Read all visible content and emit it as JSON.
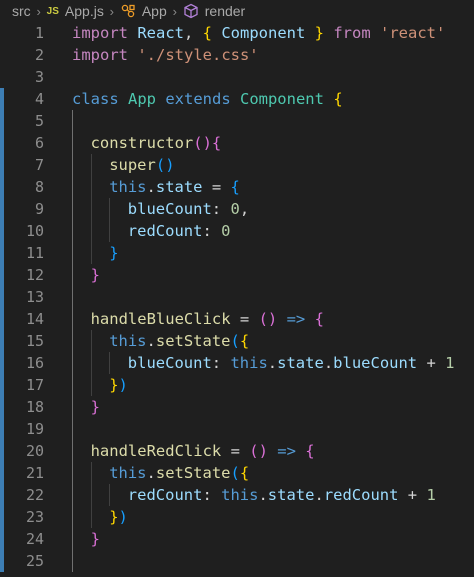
{
  "breadcrumb": {
    "folder": "src",
    "file_badge": "JS",
    "file": "App.js",
    "class_name": "App",
    "method": "render"
  },
  "lines": [
    {
      "n": "1",
      "indent": 0,
      "tokens": [
        [
          "import ",
          "k"
        ],
        [
          "React",
          "v"
        ],
        [
          ", ",
          "p"
        ],
        [
          "{",
          "y"
        ],
        [
          " Component ",
          "v"
        ],
        [
          "}",
          "y"
        ],
        [
          " from ",
          "k"
        ],
        [
          "'react'",
          "s"
        ]
      ]
    },
    {
      "n": "2",
      "indent": 0,
      "tokens": [
        [
          "import ",
          "k"
        ],
        [
          "'./style.css'",
          "s"
        ]
      ]
    },
    {
      "n": "3",
      "indent": 0,
      "tokens": []
    },
    {
      "n": "4",
      "indent": 0,
      "tokens": [
        [
          "class ",
          "b"
        ],
        [
          "App ",
          "t"
        ],
        [
          "extends ",
          "b"
        ],
        [
          "Component ",
          "t"
        ],
        [
          "{",
          "y"
        ]
      ]
    },
    {
      "n": "5",
      "indent": 1,
      "tokens": []
    },
    {
      "n": "6",
      "indent": 1,
      "tokens": [
        [
          "constructor",
          "f"
        ],
        [
          "()",
          "m"
        ],
        [
          "{",
          "m"
        ]
      ]
    },
    {
      "n": "7",
      "indent": 2,
      "tokens": [
        [
          "super",
          "f"
        ],
        [
          "()",
          "c"
        ]
      ]
    },
    {
      "n": "8",
      "indent": 2,
      "tokens": [
        [
          "this",
          "b"
        ],
        [
          ".",
          "p"
        ],
        [
          "state",
          "v"
        ],
        [
          " = ",
          "p"
        ],
        [
          "{",
          "c"
        ]
      ]
    },
    {
      "n": "9",
      "indent": 3,
      "tokens": [
        [
          "blueCount",
          "v"
        ],
        [
          ": ",
          "p"
        ],
        [
          "0",
          "n"
        ],
        [
          ",",
          "p"
        ]
      ]
    },
    {
      "n": "10",
      "indent": 3,
      "tokens": [
        [
          "redCount",
          "v"
        ],
        [
          ": ",
          "p"
        ],
        [
          "0",
          "n"
        ]
      ]
    },
    {
      "n": "11",
      "indent": 2,
      "tokens": [
        [
          "}",
          "c"
        ]
      ]
    },
    {
      "n": "12",
      "indent": 1,
      "tokens": [
        [
          "}",
          "m"
        ]
      ]
    },
    {
      "n": "13",
      "indent": 1,
      "tokens": []
    },
    {
      "n": "14",
      "indent": 1,
      "tokens": [
        [
          "handleBlueClick",
          "f"
        ],
        [
          " = ",
          "p"
        ],
        [
          "()",
          "m"
        ],
        [
          " => ",
          "b"
        ],
        [
          "{",
          "m"
        ]
      ]
    },
    {
      "n": "15",
      "indent": 2,
      "tokens": [
        [
          "this",
          "b"
        ],
        [
          ".",
          "p"
        ],
        [
          "setState",
          "f"
        ],
        [
          "(",
          "c"
        ],
        [
          "{",
          "y"
        ]
      ]
    },
    {
      "n": "16",
      "indent": 3,
      "tokens": [
        [
          "blueCount",
          "v"
        ],
        [
          ": ",
          "p"
        ],
        [
          "this",
          "b"
        ],
        [
          ".",
          "p"
        ],
        [
          "state",
          "v"
        ],
        [
          ".",
          "p"
        ],
        [
          "blueCount",
          "v"
        ],
        [
          " + ",
          "p"
        ],
        [
          "1",
          "n"
        ]
      ]
    },
    {
      "n": "17",
      "indent": 2,
      "tokens": [
        [
          "}",
          "y"
        ],
        [
          ")",
          "c"
        ]
      ]
    },
    {
      "n": "18",
      "indent": 1,
      "tokens": [
        [
          "}",
          "m"
        ]
      ]
    },
    {
      "n": "19",
      "indent": 1,
      "tokens": []
    },
    {
      "n": "20",
      "indent": 1,
      "tokens": [
        [
          "handleRedClick",
          "f"
        ],
        [
          " = ",
          "p"
        ],
        [
          "()",
          "m"
        ],
        [
          " => ",
          "b"
        ],
        [
          "{",
          "m"
        ]
      ]
    },
    {
      "n": "21",
      "indent": 2,
      "tokens": [
        [
          "this",
          "b"
        ],
        [
          ".",
          "p"
        ],
        [
          "setState",
          "f"
        ],
        [
          "(",
          "c"
        ],
        [
          "{",
          "y"
        ]
      ]
    },
    {
      "n": "22",
      "indent": 3,
      "tokens": [
        [
          "redCount",
          "v"
        ],
        [
          ": ",
          "p"
        ],
        [
          "this",
          "b"
        ],
        [
          ".",
          "p"
        ],
        [
          "state",
          "v"
        ],
        [
          ".",
          "p"
        ],
        [
          "redCount",
          "v"
        ],
        [
          " + ",
          "p"
        ],
        [
          "1",
          "n"
        ]
      ]
    },
    {
      "n": "23",
      "indent": 2,
      "tokens": [
        [
          "}",
          "y"
        ],
        [
          ")",
          "c"
        ]
      ]
    },
    {
      "n": "24",
      "indent": 1,
      "tokens": [
        [
          "}",
          "m"
        ]
      ]
    },
    {
      "n": "25",
      "indent": 1,
      "tokens": []
    }
  ],
  "modified_lines": [
    "4",
    "5",
    "6",
    "7",
    "8",
    "9",
    "10",
    "11",
    "12",
    "13",
    "14",
    "15",
    "16",
    "17",
    "18",
    "19",
    "20",
    "21",
    "22",
    "23",
    "24",
    "25"
  ],
  "colors": {
    "background": "#1f1f1f",
    "keyword": "#c586c0",
    "storage": "#569cd6",
    "type": "#4ec9b0",
    "function": "#dcdcaa",
    "variable": "#9cdcfe",
    "string": "#ce9178",
    "number": "#b5cea8",
    "bracket_gold": "#ffd700",
    "bracket_orchid": "#da70d6",
    "bracket_blue": "#179fff",
    "gutter_modified": "#3d7eb4"
  }
}
